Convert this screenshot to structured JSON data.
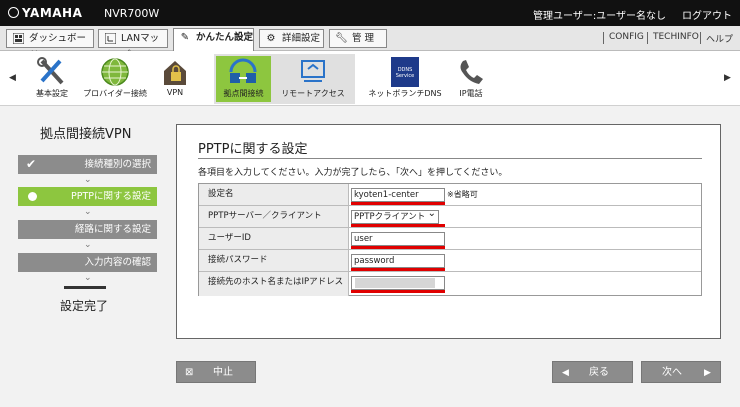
{
  "header": {
    "logo": "YAMAHA",
    "model": "NVR700W",
    "user": "管理ユーザー:ユーザー名なし",
    "logout": "ログアウト"
  },
  "tabs": [
    {
      "label": "ダッシュボード",
      "icon": "grid-icon"
    },
    {
      "label": "LANマップ",
      "icon": "map-icon"
    },
    {
      "label": "かんたん設定",
      "icon": "wand-icon"
    },
    {
      "label": "詳細設定",
      "icon": "gear-icon"
    },
    {
      "label": "管 理",
      "icon": "wrench-icon"
    }
  ],
  "toplinks": {
    "config": "CONFIG",
    "techinfo": "TECHINFO",
    "help": "ヘルプ"
  },
  "iconbar": [
    {
      "label": "基本設定",
      "icon": "tools-icon"
    },
    {
      "label": "プロバイダー接続",
      "icon": "globe-icon"
    },
    {
      "label": "VPN",
      "icon": "lock-house-icon"
    },
    {
      "label": "拠点間接続",
      "icon": "sites-icon"
    },
    {
      "label": "リモートアクセス",
      "icon": "remote-icon"
    },
    {
      "label": "ネットボランチDNS",
      "icon": "dns-icon",
      "badge": "DDNS Service"
    },
    {
      "label": "IP電話",
      "icon": "phone-icon"
    }
  ],
  "sidebar": {
    "title": "拠点間接続VPN",
    "steps": [
      {
        "label": "接続種別の選択"
      },
      {
        "label": "PPTPに関する設定"
      },
      {
        "label": "経路に関する設定"
      },
      {
        "label": "入力内容の確認"
      }
    ],
    "done": "設定完了"
  },
  "panel": {
    "title": "PPTPに関する設定",
    "desc": "各項目を入力してください。入力が完了したら、「次へ」を押してください。",
    "fields": [
      {
        "label": "設定名",
        "value": "kyoten1-center",
        "note": "※省略可"
      },
      {
        "label": "PPTPサーバー／クライアント",
        "value": "PPTPクライアント"
      },
      {
        "label": "ユーザーID",
        "value": "user"
      },
      {
        "label": "接続パスワード",
        "value": "password"
      },
      {
        "label": "接続先のホスト名またはIPアドレス",
        "value": ""
      }
    ]
  },
  "buttons": {
    "cancel": "中止",
    "back": "戻る",
    "next": "次へ"
  },
  "colors": {
    "accent": "#8dc63f",
    "step_gray": "#8c8c8c",
    "highlight": "#e00000"
  }
}
